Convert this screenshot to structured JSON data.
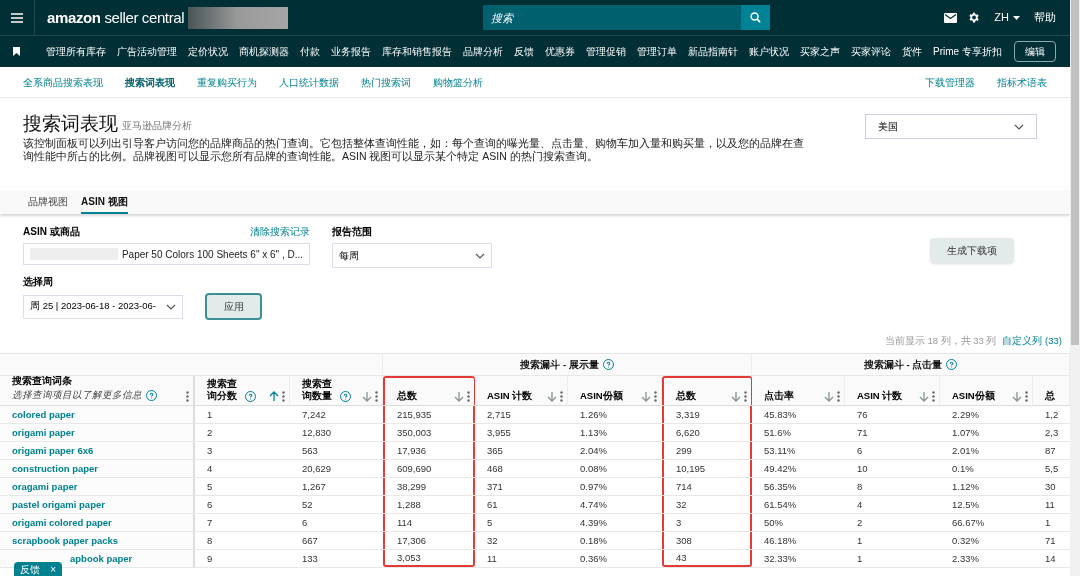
{
  "header": {
    "logo": "amazon seller central",
    "search": {
      "placeholder": "搜索"
    },
    "language": "ZH",
    "help": "帮助"
  },
  "nav": {
    "items": [
      "管理所有库存",
      "广告活动管理",
      "定价状况",
      "商机探测器",
      "付款",
      "业务报告",
      "库存和销售报告",
      "品牌分析",
      "反馈",
      "优惠券",
      "管理促销",
      "管理订单",
      "新品指南针",
      "账户状况",
      "买家之声",
      "买家评论",
      "货件",
      "Prime 专享折扣"
    ],
    "edit": "编辑"
  },
  "subnav": {
    "tabs": [
      {
        "label": "全系商品搜索表现",
        "selected": false
      },
      {
        "label": "搜索词表现",
        "selected": true
      },
      {
        "label": "重复购买行为",
        "selected": false
      },
      {
        "label": "人口统计数据",
        "selected": false
      },
      {
        "label": "热门搜索词",
        "selected": false
      },
      {
        "label": "购物篮分析",
        "selected": false
      }
    ],
    "links": [
      "下载管理器",
      "指标术语表"
    ]
  },
  "page": {
    "title": "搜索词表现",
    "subtitle": "亚马逊品牌分析",
    "description": "该控制面板可以列出引导客户访问您的品牌商品的热门查询。它包括整体查询性能，如：每个查询的曝光量、点击量、购物车加入量和购买量，以及您的品牌在查询性能中所占的比例。品牌视图可以显示您所有品牌的查询性能。ASIN 视图可以显示某个特定 ASIN 的热门搜索查询。",
    "country": "美国"
  },
  "view_tabs": [
    {
      "label": "品牌视图",
      "selected": false
    },
    {
      "label": "ASIN 视图",
      "selected": true
    }
  ],
  "form": {
    "asin_label": "ASIN 或商品",
    "clear_link": "清除搜索记录",
    "asin_value": "Paper 50 Colors 100 Sheets 6\" x 6\" , D...",
    "range_label": "报告范围",
    "range_value": "每周",
    "generate": "生成下载项",
    "week_label": "选择周",
    "week_value": "周 25 | 2023-06-18 - 2023-06-",
    "apply": "应用"
  },
  "table": {
    "info": "当前显示 18 列，共 33 列",
    "customize": "自定义列 (33)",
    "groups": [
      {
        "label": "搜索漏斗 - 展示量",
        "help": true
      },
      {
        "label": "搜索漏斗 - 点击量",
        "help": true
      }
    ],
    "columns": [
      {
        "label": "搜索查询词条",
        "hint": "选择查询项目以了解更多信息",
        "help": true,
        "highlighted": false
      },
      {
        "label": "搜索查询分数",
        "help": true,
        "ascending": true,
        "highlighted": false
      },
      {
        "label": "搜索查询数量",
        "help": true,
        "ascending": false,
        "highlighted": false
      },
      {
        "label": "总数",
        "help": false,
        "ascending": false,
        "highlighted": true
      },
      {
        "label": "ASIN 计数",
        "help": false,
        "ascending": false,
        "highlighted": false
      },
      {
        "label": "ASIN份额",
        "help": false,
        "ascending": false,
        "highlighted": false
      },
      {
        "label": "总数",
        "help": false,
        "ascending": false,
        "highlighted": true
      },
      {
        "label": "点击率",
        "help": false,
        "ascending": false,
        "highlighted": false
      },
      {
        "label": "ASIN 计数",
        "help": false,
        "ascending": false,
        "highlighted": false
      },
      {
        "label": "ASIN份额",
        "help": false,
        "ascending": false,
        "highlighted": false
      },
      {
        "label": "总",
        "help": false,
        "highlighted": false
      }
    ],
    "rows": [
      [
        "colored paper",
        "1",
        "7,242",
        "215,935",
        "2,715",
        "1.26%",
        "3,319",
        "45.83%",
        "76",
        "2.29%",
        "1,2"
      ],
      [
        "origami paper",
        "2",
        "12,830",
        "350,003",
        "3,955",
        "1.13%",
        "6,620",
        "51.6%",
        "71",
        "1.07%",
        "2,3"
      ],
      [
        "origami paper 6x6",
        "3",
        "563",
        "17,936",
        "365",
        "2.04%",
        "299",
        "53.11%",
        "6",
        "2.01%",
        "87"
      ],
      [
        "construction paper",
        "4",
        "20,629",
        "609,690",
        "468",
        "0.08%",
        "10,195",
        "49.42%",
        "10",
        "0.1%",
        "5,5"
      ],
      [
        "oragami paper",
        "5",
        "1,267",
        "38,299",
        "371",
        "0.97%",
        "714",
        "56.35%",
        "8",
        "1.12%",
        "30"
      ],
      [
        "pastel origami paper",
        "6",
        "52",
        "1,288",
        "61",
        "4.74%",
        "32",
        "61.54%",
        "4",
        "12.5%",
        "11"
      ],
      [
        "origami colored paper",
        "7",
        "6",
        "114",
        "5",
        "4.39%",
        "3",
        "50%",
        "2",
        "66.67%",
        "1"
      ],
      [
        "scrapbook paper packs",
        "8",
        "667",
        "17,306",
        "32",
        "0.18%",
        "308",
        "46.18%",
        "1",
        "0.32%",
        "71"
      ],
      [
        "apbook paper",
        "9",
        "133",
        "3,053",
        "11",
        "0.36%",
        "43",
        "32.33%",
        "1",
        "2.33%",
        "14"
      ]
    ]
  },
  "feedback": {
    "label": "反馈",
    "close": "×"
  }
}
